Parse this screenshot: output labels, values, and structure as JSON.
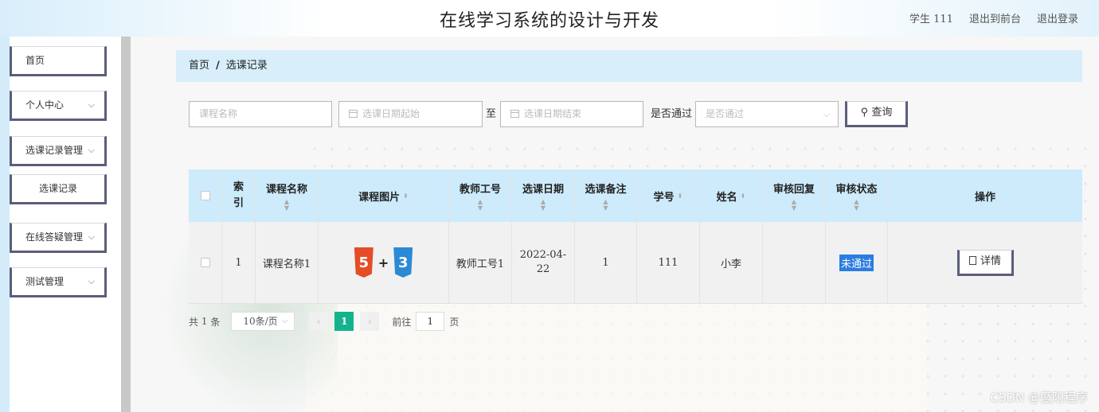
{
  "header": {
    "title": "在线学习系统的设计与开发",
    "user_role": "学生",
    "username": "111",
    "to_frontend": "退出到前台",
    "logout": "退出登录"
  },
  "sidebar": {
    "items": [
      {
        "label": "首页",
        "has_arrow": false
      },
      {
        "label": "个人中心",
        "has_arrow": true
      },
      {
        "label": "选课记录管理",
        "has_arrow": true
      },
      {
        "label": "选课记录",
        "has_arrow": false
      },
      {
        "label": "在线答疑管理",
        "has_arrow": true
      },
      {
        "label": "测试管理",
        "has_arrow": true
      }
    ]
  },
  "breadcrumb": {
    "home": "首页",
    "sep": "/",
    "current": "选课记录"
  },
  "search": {
    "course_placeholder": "课程名称",
    "date_start_placeholder": "选课日期起始",
    "to_label": "至",
    "date_end_placeholder": "选课日期结束",
    "passed_label": "是否通过",
    "passed_placeholder": "是否通过",
    "query_button": "查询"
  },
  "table": {
    "headers": [
      "索引",
      "课程名称",
      "课程图片",
      "教师工号",
      "选课日期",
      "选课备注",
      "学号",
      "姓名",
      "审核回复",
      "审核状态",
      "操作"
    ],
    "rows": [
      {
        "index": "1",
        "course_name": "课程名称1",
        "teacher_id": "教师工号1",
        "date": "2022-04-22",
        "note": "1",
        "student_id": "111",
        "name": "小李",
        "reply": "",
        "status": "未通过",
        "action": "详情"
      }
    ]
  },
  "pagination": {
    "total_prefix": "共",
    "total": "1",
    "total_suffix": "条",
    "page_size": "10条/页",
    "current_page": "1",
    "goto_label": "前往",
    "goto_value": "1",
    "goto_suffix": "页"
  },
  "watermark": "CSDN @暨阳程序",
  "colors": {
    "accent": "#14b38e",
    "header_bg": "#cdebfb",
    "badge": "#2b7de0"
  }
}
